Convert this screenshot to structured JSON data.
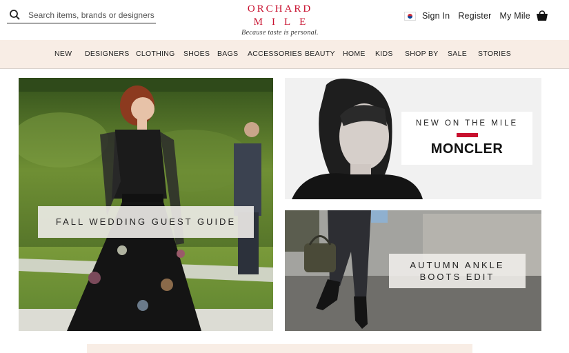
{
  "search": {
    "placeholder": "Search items, brands or designers",
    "icon": "search-icon"
  },
  "logo": {
    "line1": "ORCHARD",
    "line2": "MILE",
    "tagline": "Because taste is personal."
  },
  "account": {
    "flag": "korea-flag-icon",
    "sign_in": "Sign In",
    "register": "Register",
    "my_mile": "My Mile",
    "bag_icon": "shopping-bag-icon"
  },
  "nav": {
    "items": [
      "NEW",
      "DESIGNERS",
      "CLOTHING",
      "SHOES",
      "BAGS",
      "ACCESSORIES",
      "BEAUTY",
      "HOME",
      "KIDS",
      "SHOP BY",
      "SALE",
      "STORIES"
    ]
  },
  "tiles": {
    "left": {
      "label": "FALL WEDDING GUEST GUIDE"
    },
    "right_top": {
      "kicker": "NEW ON THE MILE",
      "brand": "MONCLER"
    },
    "right_bottom": {
      "line1": "AUTUMN ANKLE",
      "line2": "BOOTS EDIT"
    }
  },
  "colors": {
    "brand_red": "#c8102e",
    "nav_background": "#f8ede5"
  }
}
